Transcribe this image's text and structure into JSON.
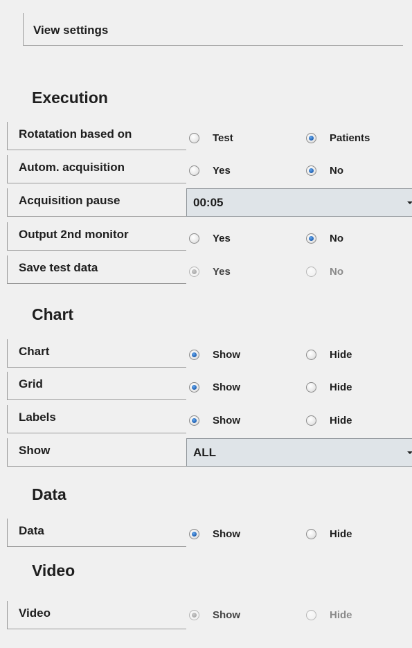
{
  "header": {
    "title": "View settings"
  },
  "execution": {
    "title": "Execution",
    "rotation": {
      "label": "Rotatation based on",
      "opt1": "Test",
      "opt2": "Patients"
    },
    "autom": {
      "label": "Autom. acquisition",
      "opt1": "Yes",
      "opt2": "No"
    },
    "pause": {
      "label": "Acquisition pause",
      "value": "00:05"
    },
    "output": {
      "label": "Output 2nd monitor",
      "opt1": "Yes",
      "opt2": "No"
    },
    "save": {
      "label": "Save test data",
      "opt1": "Yes",
      "opt2": "No"
    }
  },
  "chart": {
    "title": "Chart",
    "chart": {
      "label": "Chart",
      "opt1": "Show",
      "opt2": "Hide"
    },
    "grid": {
      "label": "Grid",
      "opt1": "Show",
      "opt2": "Hide"
    },
    "labels": {
      "label": "Labels",
      "opt1": "Show",
      "opt2": "Hide"
    },
    "show": {
      "label": "Show",
      "value": "ALL"
    }
  },
  "data": {
    "title": "Data",
    "data": {
      "label": "Data",
      "opt1": "Show",
      "opt2": "Hide"
    }
  },
  "video": {
    "title": "Video",
    "video": {
      "label": "Video",
      "opt1": "Show",
      "opt2": "Hide"
    }
  }
}
